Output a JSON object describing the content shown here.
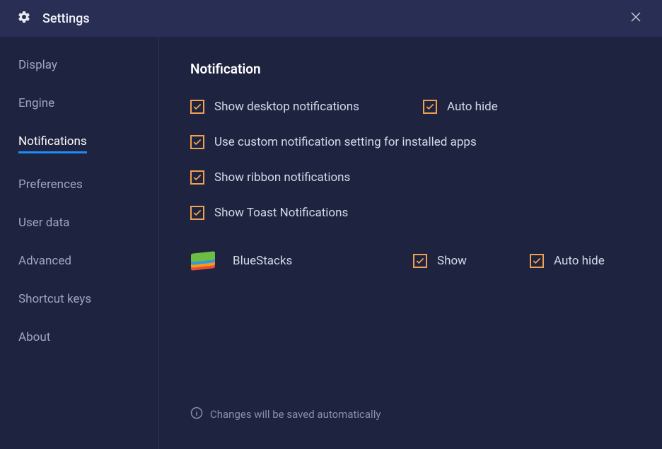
{
  "header": {
    "title": "Settings"
  },
  "sidebar": {
    "items": [
      {
        "label": "Display",
        "active": false
      },
      {
        "label": "Engine",
        "active": false
      },
      {
        "label": "Notifications",
        "active": true
      },
      {
        "label": "Preferences",
        "active": false
      },
      {
        "label": "User data",
        "active": false
      },
      {
        "label": "Advanced",
        "active": false
      },
      {
        "label": "Shortcut keys",
        "active": false
      },
      {
        "label": "About",
        "active": false
      }
    ]
  },
  "content": {
    "section_title": "Notification",
    "options": {
      "show_desktop": "Show desktop notifications",
      "auto_hide": "Auto hide",
      "custom_setting": "Use custom notification setting for installed apps",
      "show_ribbon": "Show ribbon notifications",
      "show_toast": "Show Toast Notifications"
    },
    "app": {
      "name": "BlueStacks",
      "show_label": "Show",
      "autohide_label": "Auto hide"
    },
    "footer": "Changes will be saved automatically"
  }
}
